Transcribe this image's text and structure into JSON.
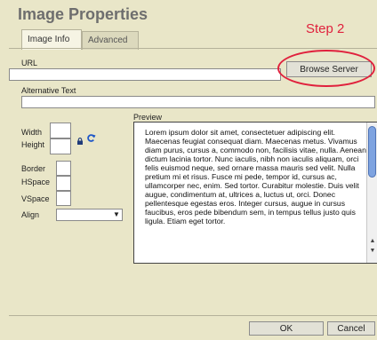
{
  "dialog": {
    "title": "Image Properties"
  },
  "tabs": [
    {
      "label": "Image Info",
      "active": true
    },
    {
      "label": "Advanced",
      "active": false
    }
  ],
  "annotation": {
    "step_label": "Step 2",
    "color": "#e0213d"
  },
  "form": {
    "url_label": "URL",
    "url_value": "",
    "browse_label": "Browse Server",
    "alt_label": "Alternative Text",
    "alt_value": "",
    "width_label": "Width",
    "height_label": "Height",
    "border_label": "Border",
    "hspace_label": "HSpace",
    "vspace_label": "VSpace",
    "align_label": "Align",
    "align_value": "",
    "lock_icon": "lock-icon",
    "reset_icon": "reset-size-icon"
  },
  "preview": {
    "label": "Preview",
    "text": "Lorem ipsum dolor sit amet, consectetuer adipiscing elit. Maecenas feugiat consequat diam. Maecenas metus. Vivamus diam purus, cursus a, commodo non, facilisis vitae, nulla. Aenean dictum lacinia tortor. Nunc iaculis, nibh non iaculis aliquam, orci felis euismod neque, sed ornare massa mauris sed velit. Nulla pretium mi et risus. Fusce mi pede, tempor id, cursus ac, ullamcorper nec, enim. Sed tortor. Curabitur molestie. Duis velit augue, condimentum at, ultrices a, luctus ut, orci. Donec pellentesque egestas eros. Integer cursus, augue in cursus faucibus, eros pede bibendum sem, in tempus tellus justo quis ligula. Etiam eget tortor."
  },
  "buttons": {
    "ok": "OK",
    "cancel": "Cancel"
  },
  "colors": {
    "dialog_bg": "#e9e6c8",
    "title": "#6e6e6e",
    "scroll_thumb": "#7ea3e0"
  }
}
